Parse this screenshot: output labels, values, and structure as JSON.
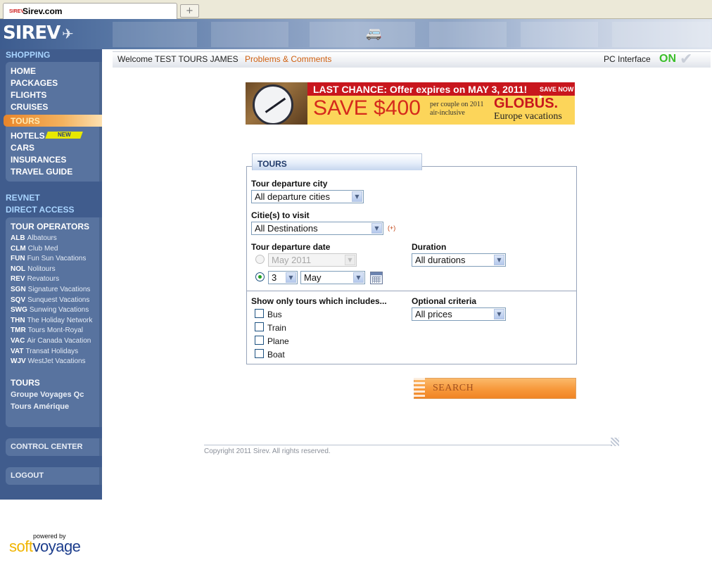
{
  "browser": {
    "tab_title": "Sirev.com",
    "favicon_text": "SIREV",
    "new_tab_icon": "+"
  },
  "header": {
    "logo": "SIREV"
  },
  "sidebar": {
    "section_shopping": "SHOPPING",
    "nav": [
      {
        "label": "HOME"
      },
      {
        "label": "PACKAGES"
      },
      {
        "label": "FLIGHTS"
      },
      {
        "label": "CRUISES"
      },
      {
        "label": "TOURS",
        "active": true
      },
      {
        "label": "HOTELS",
        "badge": "NEW"
      },
      {
        "label": "CARS"
      },
      {
        "label": "INSURANCES"
      },
      {
        "label": "TRAVEL GUIDE"
      }
    ],
    "section_revnet": "REVNET",
    "section_direct": "DIRECT ACCESS",
    "tour_operators_title": "TOUR OPERATORS",
    "tour_operators": [
      {
        "code": "ALB",
        "name": "Albatours"
      },
      {
        "code": "CLM",
        "name": "Club Med"
      },
      {
        "code": "FUN",
        "name": "Fun Sun Vacations"
      },
      {
        "code": "NOL",
        "name": "Nolitours"
      },
      {
        "code": "REV",
        "name": "Revatours"
      },
      {
        "code": "SGN",
        "name": "Signature Vacations"
      },
      {
        "code": "SQV",
        "name": "Sunquest Vacations"
      },
      {
        "code": "SWG",
        "name": "Sunwing Vacations"
      },
      {
        "code": "THN",
        "name": "The Holiday Network"
      },
      {
        "code": "TMR",
        "name": "Tours Mont-Royal"
      },
      {
        "code": "VAC",
        "name": "Air Canada Vacation"
      },
      {
        "code": "VAT",
        "name": "Transat Holidays"
      },
      {
        "code": "WJV",
        "name": "WestJet Vacations"
      }
    ],
    "tours_title": "TOURS",
    "tours_links": [
      "Groupe Voyages Qc",
      "Tours Amérique"
    ],
    "control_center": "CONTROL CENTER",
    "logout": "LOGOUT"
  },
  "topbar": {
    "welcome": "Welcome TEST TOURS JAMES",
    "problems": "Problems & Comments",
    "pc_interface": "PC Interface",
    "on": "ON"
  },
  "ad": {
    "headline": "LAST CHANCE: Offer expires on MAY 3, 2011!",
    "save_now": "SAVE NOW ▸",
    "save": "SAVE $400",
    "per_couple": "per couple on 2011 air-inclusive",
    "brand": "GLOBUS.",
    "tagline": "Europe vacations"
  },
  "tours_form": {
    "tab_title": "TOURS",
    "departure_city_label": "Tour departure city",
    "departure_city_value": "All departure cities",
    "cities_label": "Citie(s) to visit",
    "cities_value": "All Destinations",
    "cities_plus": "(+)",
    "departure_date_label": "Tour departure date",
    "month_year_value": "May 2011",
    "day_value": "3",
    "month_value": "May",
    "duration_label": "Duration",
    "duration_value": "All durations",
    "includes_label": "Show only tours which includes...",
    "includes": [
      "Bus",
      "Train",
      "Plane",
      "Boat"
    ],
    "optional_label": "Optional criteria",
    "optional_value": "All prices",
    "search_button": "SEARCH"
  },
  "footer": {
    "copyright": "Copyright 2011 Sirev. All rights reserved."
  },
  "powered_by": {
    "label": "powered by",
    "brand_soft": "soft",
    "brand_voyage": "voyage"
  }
}
